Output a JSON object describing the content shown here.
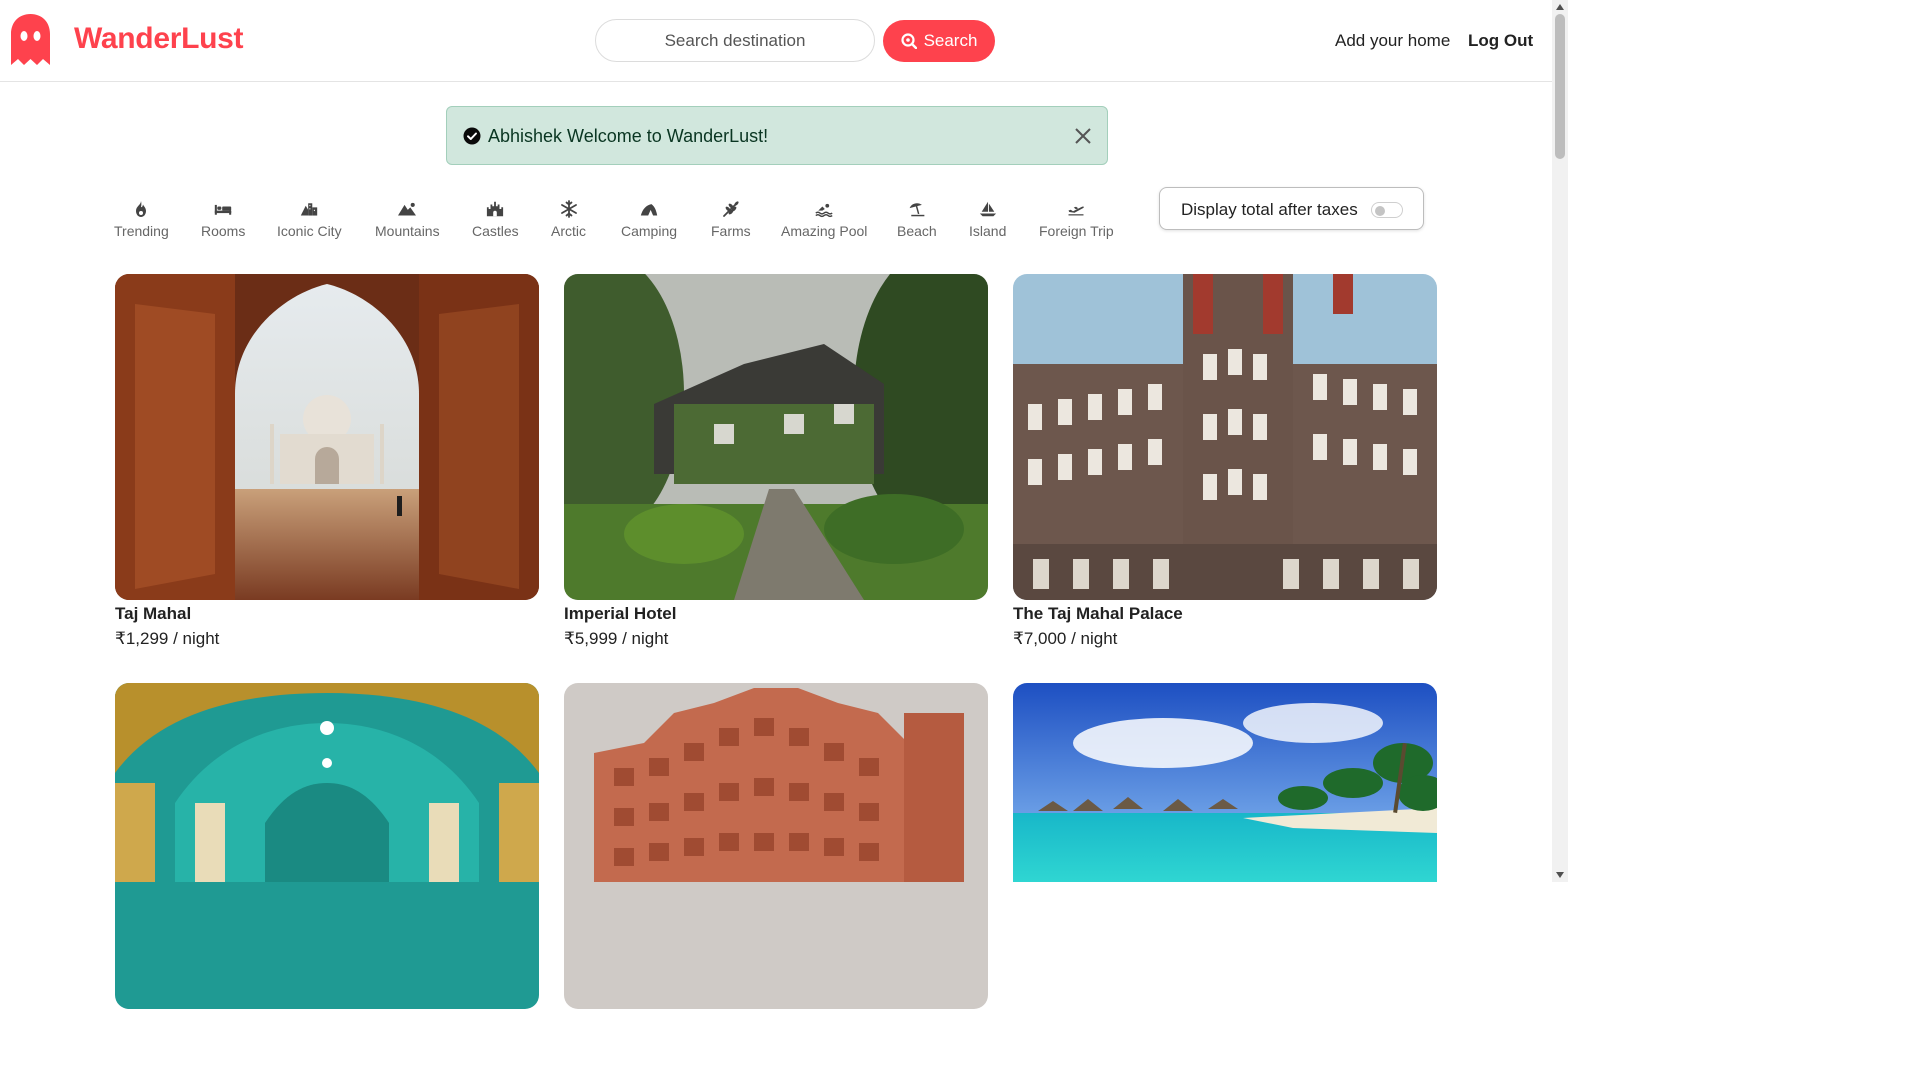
{
  "brand": {
    "name": "WanderLust",
    "color": "#fe424d"
  },
  "search": {
    "placeholder": "Search destination",
    "button_label": "Search"
  },
  "nav": {
    "add_home": "Add your home",
    "logout": "Log Out"
  },
  "alert": {
    "message": "Abhishek Welcome to WanderLust!"
  },
  "filters": [
    {
      "label": "Trending",
      "icon": "fire-icon"
    },
    {
      "label": "Rooms",
      "icon": "bed-icon"
    },
    {
      "label": "Iconic City",
      "icon": "mountain-city-icon"
    },
    {
      "label": "Mountains",
      "icon": "mountain-sun-icon"
    },
    {
      "label": "Castles",
      "icon": "fort-icon"
    },
    {
      "label": "Arctic",
      "icon": "snowflake-icon"
    },
    {
      "label": "Camping",
      "icon": "campground-icon"
    },
    {
      "label": "Farms",
      "icon": "wheat-icon"
    },
    {
      "label": "Amazing Pool",
      "icon": "person-swimming-icon"
    },
    {
      "label": "Beach",
      "icon": "umbrella-beach-icon"
    },
    {
      "label": "Island",
      "icon": "sailboat-icon"
    },
    {
      "label": "Foreign Trip",
      "icon": "plane-icon"
    }
  ],
  "tax_toggle": {
    "label": "Display total after taxes",
    "enabled": false
  },
  "listings": [
    {
      "title": "Taj Mahal",
      "price": "₹1,299 / night"
    },
    {
      "title": "Imperial Hotel",
      "price": "₹5,999 / night"
    },
    {
      "title": "The Taj Mahal Palace",
      "price": "₹7,000 / night"
    },
    {
      "title": "",
      "price": ""
    },
    {
      "title": "",
      "price": ""
    },
    {
      "title": "",
      "price": ""
    }
  ]
}
